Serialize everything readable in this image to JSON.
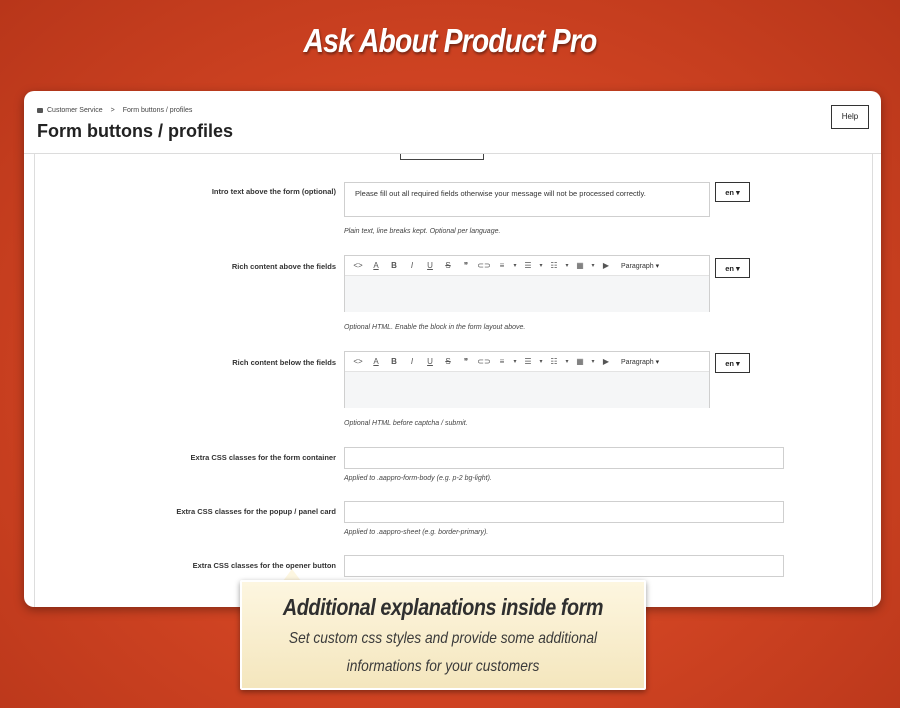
{
  "banner": {
    "title": "Ask About Product Pro"
  },
  "header": {
    "breadcrumb": [
      "Customer Service",
      ">",
      "Form buttons / profiles"
    ],
    "title": "Form buttons / profiles",
    "help_label": "Help"
  },
  "form": {
    "intro": {
      "label": "Intro text above the form (optional)",
      "value": "Please fill out all required fields otherwise your message will not be processed correctly.",
      "lang": "en ▾",
      "hint": "Plain text, line breaks kept. Optional per language."
    },
    "rich_above": {
      "label": "Rich content above the fields",
      "lang": "en ▾",
      "hint": "Optional HTML. Enable the block in the form layout above."
    },
    "rich_below": {
      "label": "Rich content below the fields",
      "lang": "en ▾",
      "hint": "Optional HTML before captcha / submit."
    },
    "css_container": {
      "label": "Extra CSS classes for the form container",
      "hint": "Applied to .aappro-form-body (e.g. p-2 bg-light)."
    },
    "css_card": {
      "label": "Extra CSS classes for the popup / panel card",
      "hint": "Applied to .aappro-sheet (e.g. border-primary)."
    },
    "css_opener": {
      "label": "Extra CSS classes for the opener button"
    }
  },
  "editor_toolbar": {
    "icons": [
      "code-icon",
      "font-color-icon",
      "bold-icon",
      "italic-icon",
      "underline-icon",
      "strikethrough-icon",
      "quote-icon",
      "link-icon",
      "align-icon",
      "bullet-list-icon",
      "numbered-list-icon",
      "table-icon",
      "media-icon"
    ],
    "glyphs": {
      "code": "<>",
      "font_color": "A",
      "bold": "B",
      "italic": "I",
      "underline": "U",
      "strike": "S",
      "quote": "❞",
      "link": "⊂⊃",
      "align": "≡",
      "bullets": "☰",
      "numbers": "☷",
      "table": "▦",
      "media": "▶",
      "caret": "▾"
    },
    "paragraph_label": "Paragraph ▾"
  },
  "callout": {
    "title": "Additional explanations inside form",
    "line1": "Set custom css styles and provide some additional",
    "line2": "informations for your customers"
  }
}
